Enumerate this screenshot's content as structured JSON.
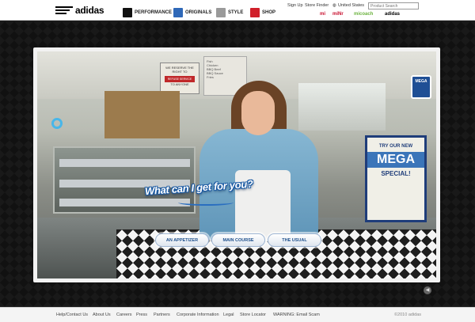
{
  "header": {
    "logo_text": "adidas",
    "nav": [
      {
        "label": "Performance",
        "icon": "performance-icon"
      },
      {
        "label": "Originals",
        "icon": "originals-trefoil-icon"
      },
      {
        "label": "Style",
        "icon": "style-icon"
      },
      {
        "label": "Shop",
        "icon": "shop-icon"
      }
    ],
    "utility": {
      "sign_up": "Sign Up",
      "store_finder": "Store Finder",
      "country": "United States",
      "search_placeholder": "Product Search"
    },
    "brands": [
      "mi",
      "miNr",
      "micoach",
      "adidas"
    ]
  },
  "scene": {
    "sign_text": "WE RESERVE THE RIGHT TO",
    "sign_red_text": "REFUSE SERVICE",
    "sign_sub": "TO ANYONE",
    "menu_board_lines": [
      "Fish",
      "Chicken",
      "BBQ Beef",
      "BBQ Sauce",
      "Fries"
    ],
    "badge_text": "MEGA",
    "promo_card": {
      "line1": "TRY OUR NEW",
      "line2": "MEGA",
      "line3": "SPECIAL!"
    }
  },
  "prompt": "What can I get for you?",
  "choices": [
    "An Appetizer",
    "Main Course",
    "The Usual"
  ],
  "footer": {
    "links": [
      "Help/Contact Us",
      "About Us",
      "Careers",
      "Press",
      "Partners",
      "Corporate Information",
      "Legal",
      "Store Locator",
      "WARNING: Email Scam"
    ],
    "copyright": "©2010 adidas"
  },
  "colors": {
    "accent_blue": "#1d4f8c",
    "shop_red": "#d0202a",
    "brand_red": "#c8102e",
    "micoach_green": "#6cb33f"
  }
}
